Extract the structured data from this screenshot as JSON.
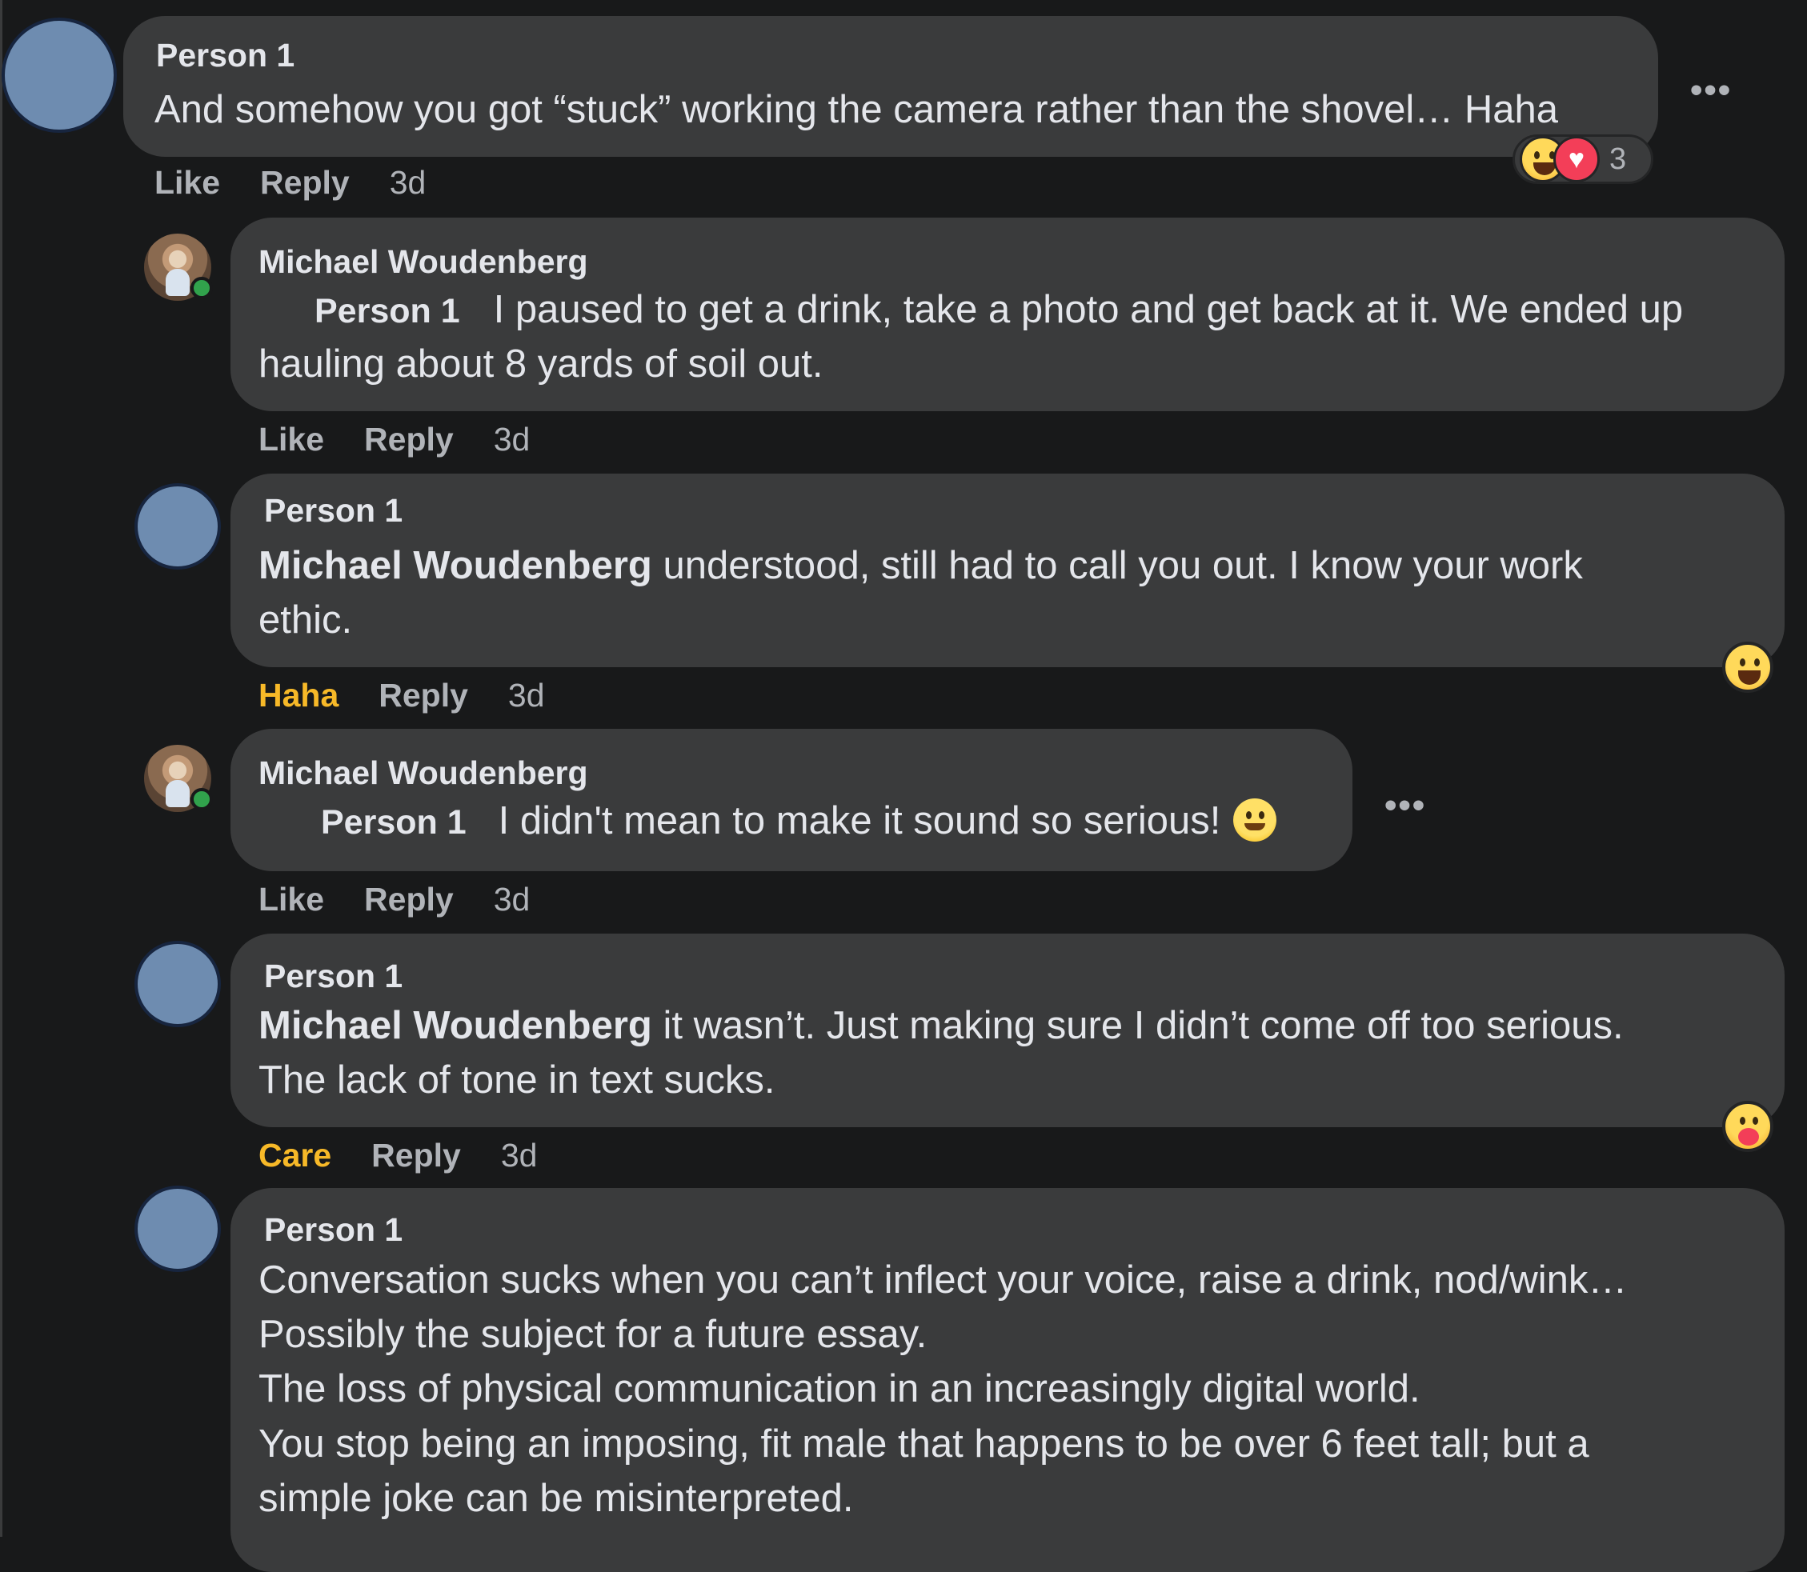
{
  "comments": [
    {
      "author": "Person 1",
      "text": "And somehow you got “stuck” working the camera rather than the shovel… Haha",
      "actions": {
        "like": "Like",
        "reply": "Reply",
        "time": "3d"
      },
      "reaction_count": "3",
      "more": "•••"
    },
    {
      "author": "Michael Woudenberg",
      "mention": "Person 1",
      "text": "I paused to get a drink, take a photo and get back at it. We ended up",
      "text2": "hauling about 8 yards of soil out.",
      "actions": {
        "like": "Like",
        "reply": "Reply",
        "time": "3d"
      }
    },
    {
      "author": "Person 1",
      "mention": "Michael Woudenberg",
      "text": "understood, still had to call you out. I know your work",
      "text2": "ethic.",
      "actions": {
        "like": "Haha",
        "reply": "Reply",
        "time": "3d"
      }
    },
    {
      "author": "Michael Woudenberg",
      "mention": "Person 1",
      "text": "I didn't mean to make it sound so serious!",
      "actions": {
        "like": "Like",
        "reply": "Reply",
        "time": "3d"
      },
      "more": "•••"
    },
    {
      "author": "Person 1",
      "mention": "Michael Woudenberg",
      "text": "it wasn’t. Just making sure I didn’t come off too serious.",
      "text2": "The lack of tone in text sucks.",
      "actions": {
        "like": "Care",
        "reply": "Reply",
        "time": "3d"
      }
    },
    {
      "author": "Person 1",
      "lines": [
        "Conversation sucks when you can’t inflect your voice, raise a drink, nod/wink…",
        "Possibly the subject for a future essay.",
        "The loss of physical communication in an increasingly digital world.",
        "You stop being an imposing, fit male that happens to be over 6 feet tall; but a",
        "simple joke can be misinterpreted."
      ]
    }
  ],
  "colors": {
    "background": "#18191a",
    "bubble": "#3a3b3c",
    "meta": "#b0b3b8",
    "reaction_active": "#f7b928",
    "online": "#31a24c"
  }
}
